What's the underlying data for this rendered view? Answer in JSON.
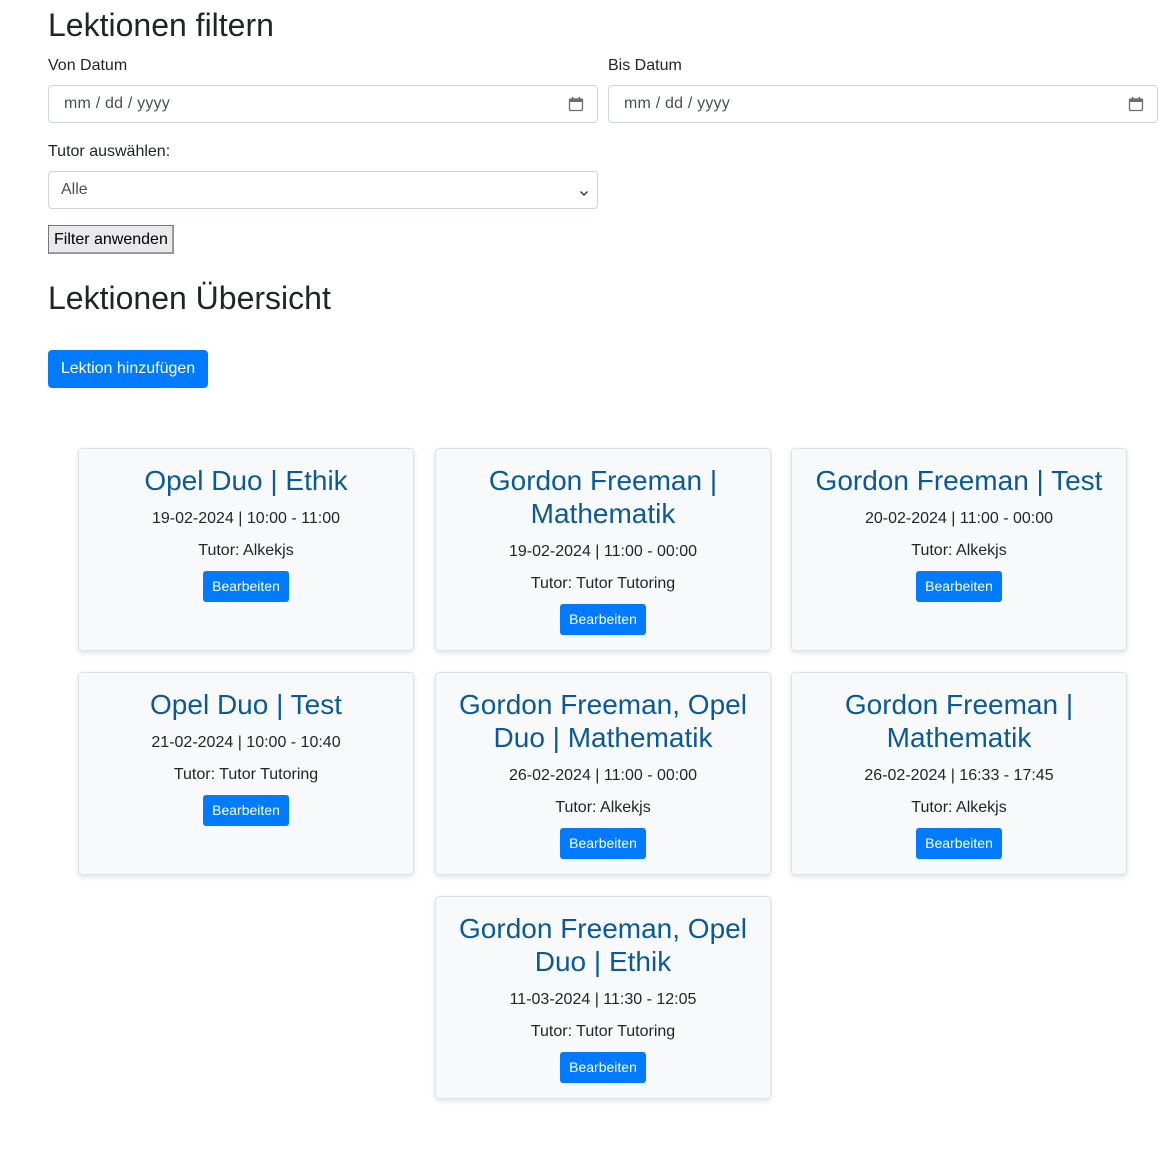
{
  "filter": {
    "title": "Lektionen filtern",
    "from_label": "Von Datum",
    "from_placeholder": "mm / dd / yyyy",
    "to_label": "Bis Datum",
    "to_placeholder": "mm / dd / yyyy",
    "tutor_label": "Tutor auswählen:",
    "tutor_selected": "Alle",
    "apply_label": "Filter anwenden"
  },
  "overview": {
    "title": "Lektionen Übersicht",
    "add_label": "Lektion hinzufügen"
  },
  "lessons": [
    {
      "title": "Opel Duo | Ethik",
      "datetime": "19-02-2024 | 10:00 - 11:00",
      "tutor": "Tutor: Alkekjs",
      "edit_label": "Bearbeiten"
    },
    {
      "title": "Gordon Freeman | Mathematik",
      "datetime": "19-02-2024 | 11:00 - 00:00",
      "tutor": "Tutor: Tutor Tutoring",
      "edit_label": "Bearbeiten"
    },
    {
      "title": "Gordon Freeman | Test",
      "datetime": "20-02-2024 | 11:00 - 00:00",
      "tutor": "Tutor: Alkekjs",
      "edit_label": "Bearbeiten"
    },
    {
      "title": "Opel Duo | Test",
      "datetime": "21-02-2024 | 10:00 - 10:40",
      "tutor": "Tutor: Tutor Tutoring",
      "edit_label": "Bearbeiten"
    },
    {
      "title": "Gordon Freeman, Opel Duo | Mathematik",
      "datetime": "26-02-2024 | 11:00 - 00:00",
      "tutor": "Tutor: Alkekjs",
      "edit_label": "Bearbeiten"
    },
    {
      "title": "Gordon Freeman | Mathematik",
      "datetime": "26-02-2024 | 16:33 - 17:45",
      "tutor": "Tutor: Alkekjs",
      "edit_label": "Bearbeiten"
    },
    {
      "title": "Gordon Freeman, Opel Duo | Ethik",
      "datetime": "11-03-2024 | 11:30 - 12:05",
      "tutor": "Tutor: Tutor Tutoring",
      "edit_label": "Bearbeiten"
    }
  ],
  "colors": {
    "primary": "#007bff",
    "card_title": "#0b5a96",
    "card_bg": "#f8f9fa"
  },
  "icons": {
    "date_picker": "calendar-icon",
    "select": "chevron-down-icon"
  }
}
